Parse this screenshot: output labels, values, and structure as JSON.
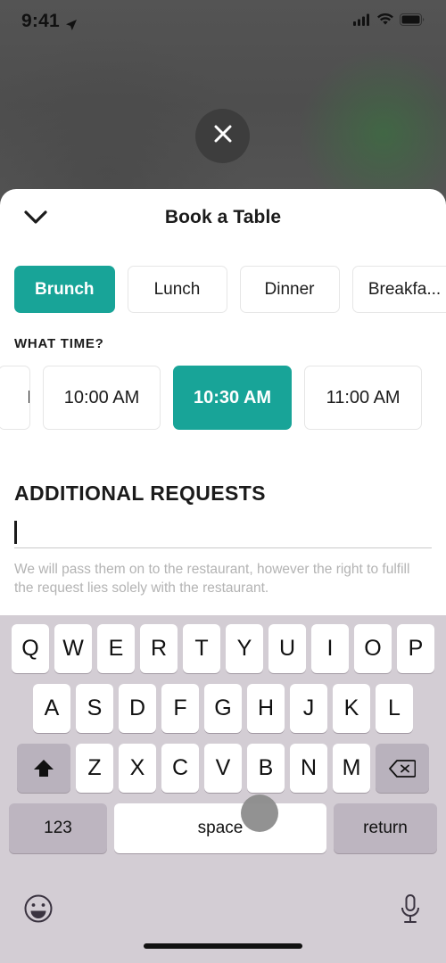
{
  "status_bar": {
    "time": "9:41",
    "location_icon": "location-arrow-icon",
    "signal_icon": "cellular-signal-icon",
    "wifi_icon": "wifi-icon",
    "battery_icon": "battery-full-icon"
  },
  "backdrop": {
    "close_button_icon": "close-x-icon",
    "dim_color": "#4e4e4e"
  },
  "sheet": {
    "title": "Book a Table",
    "collapse_icon": "chevron-down-icon",
    "meal_section": {
      "options": [
        {
          "label": "Brunch",
          "selected": true
        },
        {
          "label": "Lunch",
          "selected": false
        },
        {
          "label": "Dinner",
          "selected": false
        },
        {
          "label": "Breakfa...",
          "selected": false
        }
      ]
    },
    "time_section": {
      "label": "WHAT TIME?",
      "options": [
        {
          "label": "M",
          "selected": false,
          "clipped": true
        },
        {
          "label": "10:00 AM",
          "selected": false
        },
        {
          "label": "10:30 AM",
          "selected": true
        },
        {
          "label": "11:00 AM",
          "selected": false
        }
      ]
    },
    "requests_section": {
      "title": "ADDITIONAL REQUESTS",
      "input_value": "",
      "input_placeholder": "",
      "hint": "We will pass them on to the restaurant, however the right to fulfill the request lies solely with the restaurant."
    },
    "accent_color": "#18a498"
  },
  "keyboard": {
    "row1": [
      "Q",
      "W",
      "E",
      "R",
      "T",
      "Y",
      "U",
      "I",
      "O",
      "P"
    ],
    "row2": [
      "A",
      "S",
      "D",
      "F",
      "G",
      "H",
      "J",
      "K",
      "L"
    ],
    "row3": [
      "Z",
      "X",
      "C",
      "V",
      "B",
      "N",
      "M"
    ],
    "shift_icon": "shift-arrow-icon",
    "backspace_icon": "backspace-delete-icon",
    "numbers_key": "123",
    "space_key": "space",
    "return_key": "return",
    "emoji_icon": "emoji-smiley-icon",
    "dictation_icon": "microphone-icon",
    "background_color": "#d3cdd4"
  },
  "touch_indicator": {
    "visible": true,
    "color": "#8c8c8c"
  }
}
